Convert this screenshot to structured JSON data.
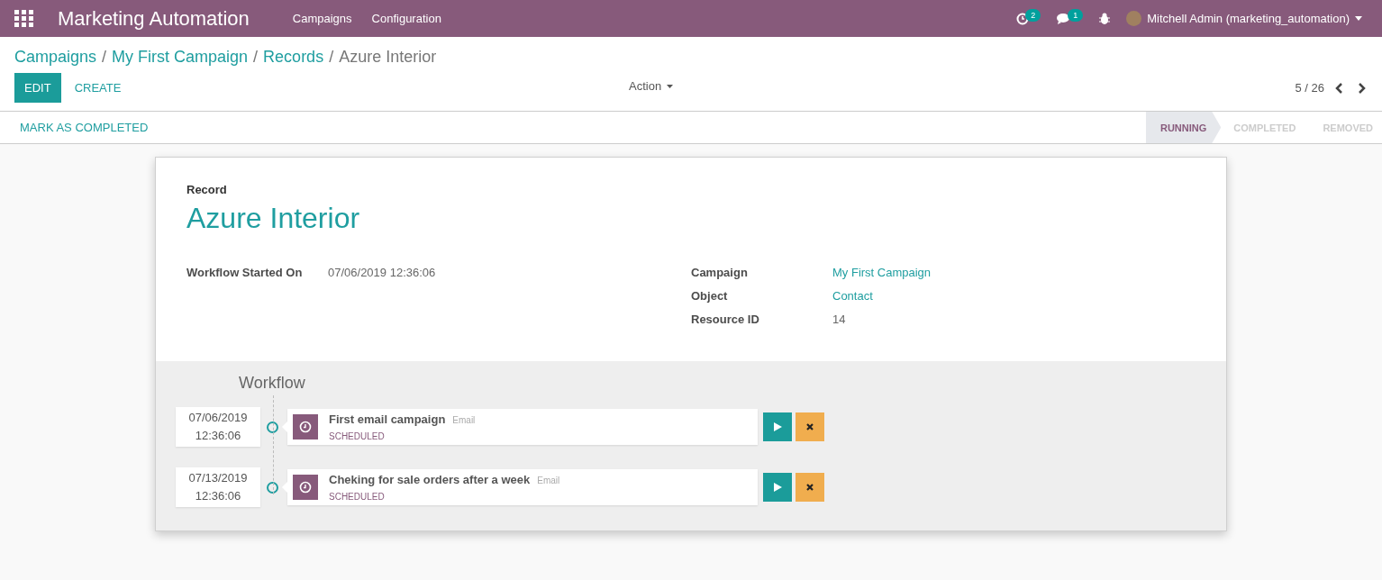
{
  "navbar": {
    "app_title": "Marketing Automation",
    "menus": [
      "Campaigns",
      "Configuration"
    ],
    "activity_count": "2",
    "message_count": "1",
    "user": "Mitchell Admin (marketing_automation)"
  },
  "breadcrumb_separator": "/",
  "breadcrumbs": [
    {
      "label": "Campaigns",
      "kind": "link"
    },
    {
      "label": "My First Campaign",
      "kind": "link"
    },
    {
      "label": "Records",
      "kind": "link"
    },
    {
      "label": "Azure Interior",
      "kind": "current"
    }
  ],
  "buttons": {
    "edit": "EDIT",
    "create": "CREATE",
    "action": "Action"
  },
  "pager": "5 / 26",
  "status_bar": {
    "button": "MARK AS COMPLETED",
    "stages": [
      {
        "label": "RUNNING",
        "selected": true
      },
      {
        "label": "COMPLETED",
        "selected": false
      },
      {
        "label": "REMOVED",
        "selected": false
      }
    ]
  },
  "record": {
    "label": "Record",
    "title": "Azure Interior",
    "left_fields": [
      {
        "label": "Workflow Started On",
        "value": "07/06/2019 12:36:06",
        "kind": "text"
      }
    ],
    "right_fields": [
      {
        "label": "Campaign",
        "value": "My First Campaign",
        "kind": "link"
      },
      {
        "label": "Object",
        "value": "Contact",
        "kind": "link"
      },
      {
        "label": "Resource ID",
        "value": "14",
        "kind": "text"
      }
    ]
  },
  "workflow": {
    "title": "Workflow",
    "items": [
      {
        "date": "07/06/2019",
        "time": "12:36:06",
        "name": "First email campaign",
        "type": "Email",
        "state": "SCHEDULED"
      },
      {
        "date": "07/13/2019",
        "time": "12:36:06",
        "name": "Cheking for sale orders after a week",
        "type": "Email",
        "state": "SCHEDULED"
      }
    ]
  }
}
